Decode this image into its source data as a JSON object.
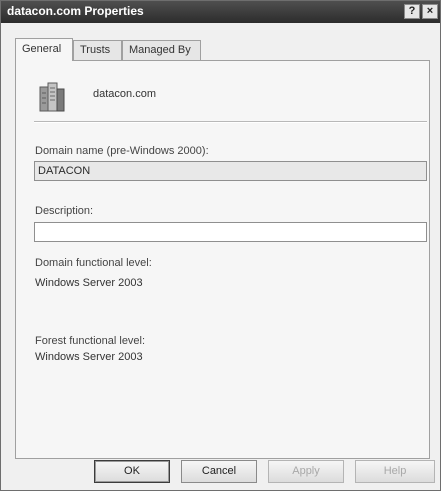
{
  "window": {
    "title": "datacon.com Properties",
    "help_button": "?",
    "close_button": "×"
  },
  "tabs": [
    {
      "label": "General",
      "active": true
    },
    {
      "label": "Trusts",
      "active": false
    },
    {
      "label": "Managed By",
      "active": false
    }
  ],
  "general": {
    "domain_icon": "domain-icon",
    "domain_title": "datacon.com",
    "pre2000_label": "Domain name (pre-Windows 2000):",
    "pre2000_value": "DATACON",
    "description_label": "Description:",
    "description_value": "",
    "domain_level_label": "Domain functional level:",
    "domain_level_value": "Windows Server 2003",
    "forest_level_label": "Forest functional level:",
    "forest_level_value": "Windows Server 2003"
  },
  "buttons": {
    "ok": "OK",
    "cancel": "Cancel",
    "apply": "Apply",
    "help": "Help"
  }
}
